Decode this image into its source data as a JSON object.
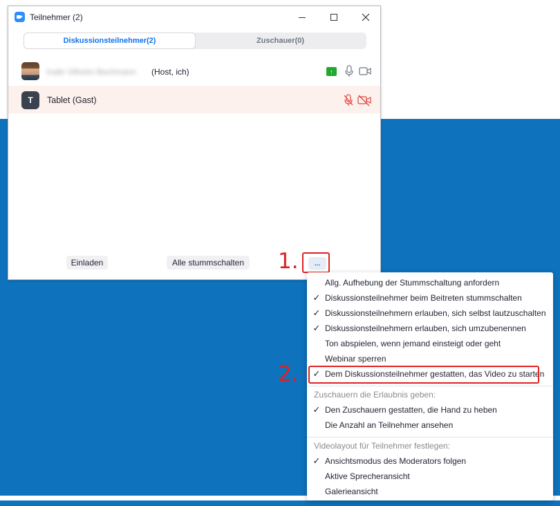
{
  "window": {
    "title": "Teilnehmer (2)",
    "tabs": [
      {
        "label": "Diskussionsteilnehmer(2)",
        "active": true
      },
      {
        "label": "Zuschauer(0)",
        "active": false
      }
    ]
  },
  "participants": [
    {
      "name_blurred": "Inafe Vilhelm Bachmann",
      "suffix": "(Host, ich)",
      "icons": [
        "share-screen-icon",
        "microphone-icon",
        "camera-icon"
      ]
    },
    {
      "avatar_letter": "T",
      "name": "Tablet (Gast)",
      "icons": [
        "microphone-muted-icon",
        "camera-off-icon"
      ]
    }
  ],
  "buttons": {
    "invite": "Einladen",
    "mute_all": "Alle stummschalten",
    "more": "..."
  },
  "annotations": {
    "step1": "1.",
    "step2": "2."
  },
  "menu": {
    "items": [
      {
        "label": "Allg. Aufhebung der Stummschaltung anfordern",
        "checked": false
      },
      {
        "label": "Diskussionsteilnehmer beim Beitreten stummschalten",
        "checked": true
      },
      {
        "label": "Diskussionsteilnehmern erlauben, sich selbst lautzuschalten",
        "checked": true
      },
      {
        "label": "Diskussionsteilnehmern erlauben, sich umzubenennen",
        "checked": true
      },
      {
        "label": "Ton abspielen, wenn jemand einsteigt oder geht",
        "checked": false
      },
      {
        "label": "Webinar sperren",
        "checked": false
      },
      {
        "label": "Dem Diskussionsteilnehmer gestatten, das Video zu starten",
        "checked": true
      }
    ],
    "section_attendees": "Zuschauern die Erlaubnis geben:",
    "attendee_items": [
      {
        "label": "Den Zuschauern gestatten, die Hand zu heben",
        "checked": true
      },
      {
        "label": "Die Anzahl an Teilnehmer ansehen",
        "checked": false
      }
    ],
    "section_layout": "Videolayout für Teilnehmer festlegen:",
    "layout_items": [
      {
        "label": "Ansichtsmodus des Moderators folgen",
        "checked": true
      },
      {
        "label": "Aktive Sprecheransicht",
        "checked": false
      },
      {
        "label": "Galerieansicht",
        "checked": false
      }
    ],
    "check_glyph": "✓"
  },
  "colors": {
    "accent_blue": "#0e72ed",
    "background_blue": "#0e72bd",
    "annotation_red": "#e02020",
    "share_green": "#22a830"
  }
}
